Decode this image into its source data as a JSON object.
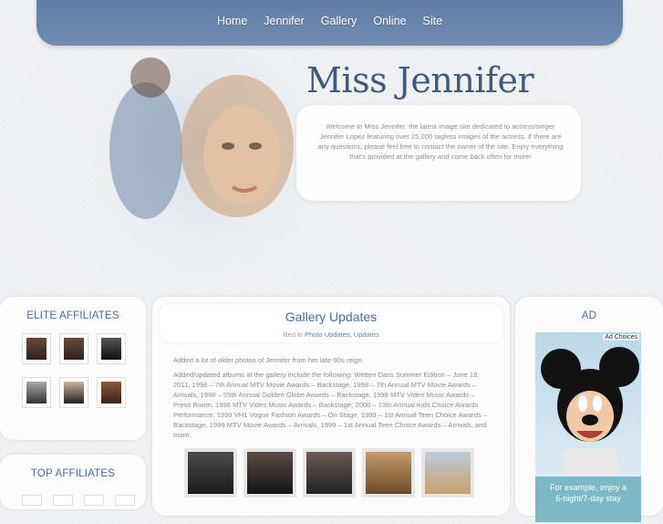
{
  "nav": {
    "items": [
      "Home",
      "Jennifer",
      "Gallery",
      "Online",
      "Site"
    ]
  },
  "header": {
    "title": "Miss Jennifer",
    "welcome": "Welcome to Miss Jennifer, the latest image site dedicated to actress/singer Jennifer Lopez featuring over 25,000 tagless images of the actress. If there are any questions, please feel free to contact the owner of the site. Enjoy everything that's provided at the gallery and come back often for more!"
  },
  "sidebar": {
    "elite_title": "ELITE AFFILIATES",
    "top_title": "TOP AFFILIATES"
  },
  "post": {
    "title": "Gallery Updates",
    "filed_in": "filed in",
    "categories": "Photo Updates, Updates",
    "paragraph1": "Added a lot of older photos of Jennifer from her late-90s reign.",
    "paragraph2": "Added/updated albums at the gallery include the following: Wetten Dass Summer Edition – June 18, 2011, 1998 – 7th Annual MTV Movie Awards – Backstage, 1998 – 7th Annual MTV Movie Awards – Arrivals, 1998 – 55th Annual Golden Globe Awards – Backstage, 1998 MTV Video Music Awards – Press Room, 1998 MTV Video Music Awards – Backstage, 2000 – 13th Annual Kids Choice Awards Performance, 1999 VH1 Vogue Fashion Awards – On Stage, 1999 – 1st Annual Teen Choice Awards – Backstage, 1999 MTV Movie Awards – Arrivals, 1999 – 1st Annual Teen Choice Awards – Arrivals, and more."
  },
  "ad": {
    "title": "AD",
    "choices": "Ad Choices",
    "text_line1": "For example, enjoy a",
    "text_line2": "6-night/7-day stay"
  },
  "colors": {
    "nav_bg": "#6584ad",
    "title": "#3f5a80",
    "accent": "#4a6b99"
  }
}
